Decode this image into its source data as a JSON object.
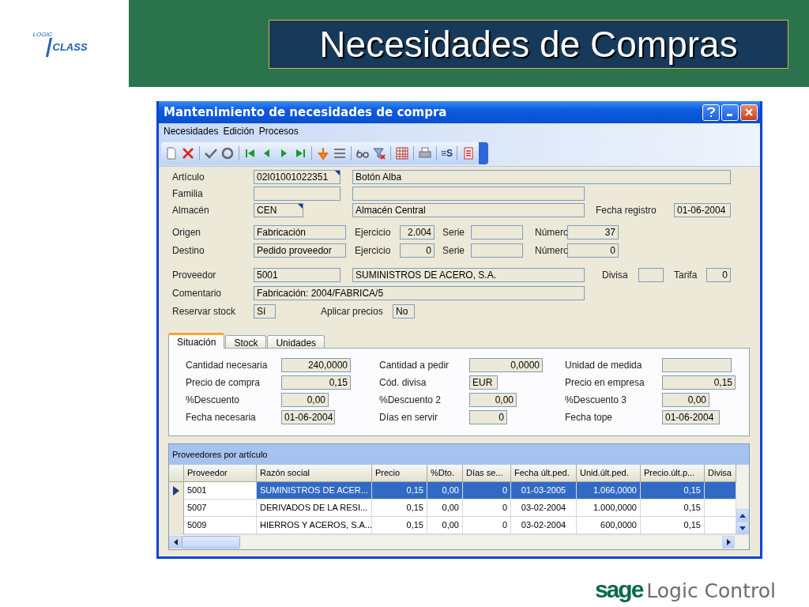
{
  "slide": {
    "logo": {
      "top": "LOGIC",
      "bottom": "CLASS"
    },
    "title": "Necesidades de Compras",
    "footer": {
      "brand": "sage",
      "product": "Logic Control"
    }
  },
  "window": {
    "title": "Mantenimiento de necesidades de compra",
    "menu": [
      "Necesidades",
      "Edición",
      "Procesos"
    ],
    "toolbar_text": "≡S",
    "form_rows": [
      [
        {
          "kind": "label",
          "text": "Artículo"
        },
        {
          "kind": "lookup",
          "value": "02I01001022351"
        },
        {
          "kind": "text",
          "value": "Botón Alba"
        }
      ],
      [
        {
          "kind": "label",
          "text": "Familia"
        },
        {
          "kind": "text"
        },
        {
          "kind": "text"
        }
      ],
      [
        {
          "kind": "label",
          "text": "Almacén"
        },
        {
          "kind": "lookup",
          "value": "CEN"
        },
        {
          "kind": "text",
          "value": "Almacén Central"
        },
        {
          "kind": "label",
          "text": "Fecha registro"
        },
        {
          "kind": "text",
          "value": "01-06-2004"
        }
      ],
      [
        {
          "kind": "label",
          "text": "Origen"
        },
        {
          "kind": "text",
          "value": "Fabricación"
        },
        {
          "kind": "label",
          "text": "Ejercicio"
        },
        {
          "kind": "number",
          "value": "2.004"
        },
        {
          "kind": "label",
          "text": "Serie"
        },
        {
          "kind": "text"
        },
        {
          "kind": "label",
          "text": "Número"
        },
        {
          "kind": "number",
          "value": "37"
        }
      ],
      [
        {
          "kind": "label",
          "text": "Destino"
        },
        {
          "kind": "text",
          "value": "Pedido proveedor"
        },
        {
          "kind": "label",
          "text": "Ejercicio"
        },
        {
          "kind": "number",
          "value": "0"
        },
        {
          "kind": "label",
          "text": "Serie"
        },
        {
          "kind": "text"
        },
        {
          "kind": "label",
          "text": "Número"
        },
        {
          "kind": "number",
          "value": "0"
        }
      ],
      [
        {
          "kind": "label",
          "text": "Proveedor"
        },
        {
          "kind": "text",
          "value": "5001"
        },
        {
          "kind": "text",
          "value": "SUMINISTROS DE ACERO, S.A."
        },
        {
          "kind": "label",
          "text": "Divisa"
        },
        {
          "kind": "text"
        },
        {
          "kind": "label",
          "text": "Tarifa"
        },
        {
          "kind": "number",
          "value": "0"
        }
      ],
      [
        {
          "kind": "label",
          "text": "Comentario"
        },
        {
          "kind": "text",
          "value": "Fabricación: 2004/FABRICA/5"
        }
      ],
      [
        {
          "kind": "label",
          "text": "Reservar stock"
        },
        {
          "kind": "text",
          "value": "Sí"
        },
        {
          "kind": "label",
          "text": "Aplicar precios"
        },
        {
          "kind": "text",
          "value": "No"
        }
      ]
    ],
    "tabs": [
      {
        "label": "Situación",
        "selected": true
      },
      {
        "label": "Stock",
        "selected": false
      },
      {
        "label": "Unidades",
        "selected": false
      }
    ],
    "tab_rows": [
      [
        {
          "kind": "label",
          "text": "Cantidad necesaria"
        },
        {
          "kind": "number",
          "value": "240,0000"
        },
        {
          "kind": "label",
          "text": "Cantidad a pedir"
        },
        {
          "kind": "number",
          "value": "0,0000"
        },
        {
          "kind": "label",
          "text": "Unidad de medida"
        },
        {
          "kind": "text"
        }
      ],
      [
        {
          "kind": "label",
          "text": "Precio de compra"
        },
        {
          "kind": "number",
          "value": "0,15"
        },
        {
          "kind": "label",
          "text": "Cód. divisa"
        },
        {
          "kind": "text",
          "value": "EUR"
        },
        {
          "kind": "label",
          "text": "Precio en empresa"
        },
        {
          "kind": "number",
          "value": "0,15"
        }
      ],
      [
        {
          "kind": "label",
          "text": "%Descuento"
        },
        {
          "kind": "number",
          "value": "0,00"
        },
        {
          "kind": "label",
          "text": "%Descuento 2"
        },
        {
          "kind": "number",
          "value": "0,00"
        },
        {
          "kind": "label",
          "text": "%Descuento 3"
        },
        {
          "kind": "number",
          "value": "0,00"
        }
      ],
      [
        {
          "kind": "label",
          "text": "Fecha necesaria"
        },
        {
          "kind": "text",
          "value": "01-06-2004"
        },
        {
          "kind": "label",
          "text": "Días en servir"
        },
        {
          "kind": "number",
          "value": "0"
        },
        {
          "kind": "label",
          "text": "Fecha tope"
        },
        {
          "kind": "text",
          "value": "01-06-2004"
        }
      ]
    ],
    "grid": {
      "title": "Proveedores por artículo",
      "columns": [
        "Proveedor",
        "Razón social",
        "Precio",
        "%Dto.",
        "Días se...",
        "Fecha últ.ped.",
        "Unid.últ.ped.",
        "Precio.últ.p...",
        "Divisa"
      ],
      "rows": [
        {
          "selected": true,
          "cells": [
            "5001",
            "SUMINISTROS DE ACER...",
            "0,15",
            "0,00",
            "0",
            "01-03-2005",
            "1.066,0000",
            "0,15"
          ]
        },
        {
          "selected": false,
          "cells": [
            "5007",
            "DERIVADOS DE LA RESI...",
            "0,15",
            "0,00",
            "0",
            "03-02-2004",
            "1.000,0000",
            "0,15"
          ]
        },
        {
          "selected": false,
          "cells": [
            "5009",
            "HIERROS Y ACEROS, S.A...",
            "0,15",
            "0,00",
            "0",
            "03-02-2004",
            "600,0000",
            "0,15"
          ]
        }
      ]
    }
  }
}
